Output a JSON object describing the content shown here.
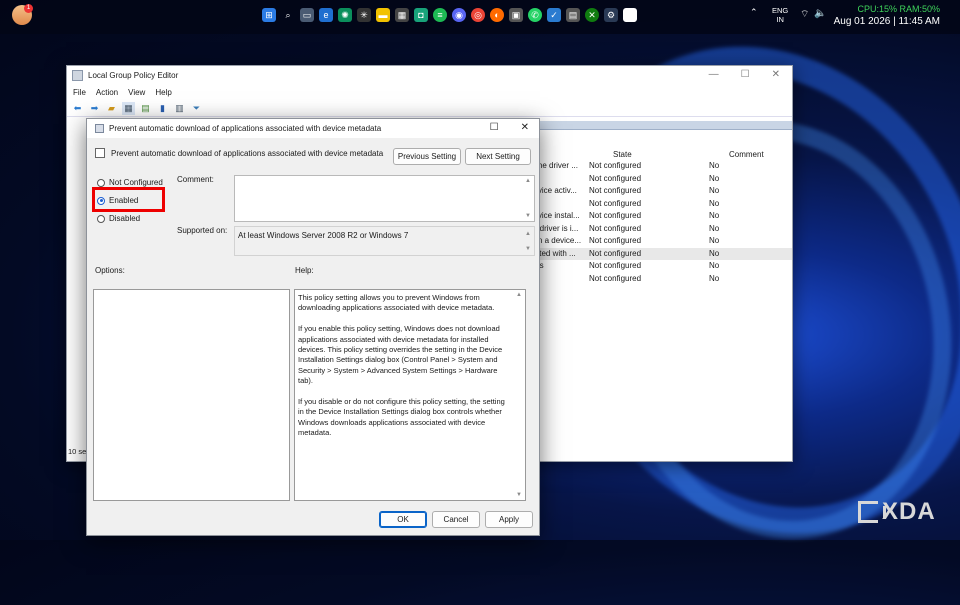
{
  "taskbar": {
    "badge": "1",
    "lang_top": "ENG",
    "lang_bottom": "IN",
    "cpu_ram": "CPU:15% RAM:50%",
    "clock": "Aug 01 2026 | 11:45 AM"
  },
  "bg_window": {
    "title": "Local Group Policy Editor",
    "menu": [
      "File",
      "Action",
      "View",
      "Help"
    ],
    "columns": {
      "state": "State",
      "comment": "Comment"
    },
    "rows": [
      {
        "setting": "g the driver ...",
        "state": "Not configured",
        "comment": "No"
      },
      {
        "setting": "",
        "state": "Not configured",
        "comment": "No"
      },
      {
        "setting": "device activ...",
        "state": "Not configured",
        "comment": "No"
      },
      {
        "setting": "",
        "state": "Not configured",
        "comment": "No"
      },
      {
        "setting": "device instal...",
        "state": "Not configured",
        "comment": "No"
      },
      {
        "setting": "ric driver is i...",
        "state": "Not configured",
        "comment": "No"
      },
      {
        "setting": "hen a device...",
        "state": "Not configured",
        "comment": "No"
      },
      {
        "setting": "ciated with ...",
        "state": "Not configured",
        "comment": "No"
      },
      {
        "setting": "ions",
        "state": "Not configured",
        "comment": "No"
      },
      {
        "setting": "",
        "state": "Not configured",
        "comment": "No"
      }
    ],
    "status": "10 sett"
  },
  "dialog": {
    "title": "Prevent automatic download of applications associated with device metadata",
    "policy_name": "Prevent automatic download of applications associated with device metadata",
    "prev_button": "Previous Setting",
    "next_button": "Next Setting",
    "radio_not_configured": "Not Configured",
    "radio_enabled": "Enabled",
    "radio_disabled": "Disabled",
    "selected_option": "Enabled",
    "comment_label": "Comment:",
    "comment_value": "",
    "supported_label": "Supported on:",
    "supported_value": "At least Windows Server 2008 R2 or Windows 7",
    "options_label": "Options:",
    "help_label": "Help:",
    "help_p1": "This policy setting allows you to prevent Windows from downloading applications associated with device metadata.",
    "help_p2": "If you enable this policy setting, Windows does not download applications associated with device metadata for installed devices. This policy setting overrides the setting in the Device Installation Settings dialog box (Control Panel > System and Security > System > Advanced System Settings > Hardware tab).",
    "help_p3": "If you disable or do not configure this policy setting, the setting in the Device Installation Settings dialog box controls whether Windows downloads applications associated with device metadata.",
    "ok_button": "OK",
    "cancel_button": "Cancel",
    "apply_button": "Apply"
  },
  "watermark": "XDA"
}
